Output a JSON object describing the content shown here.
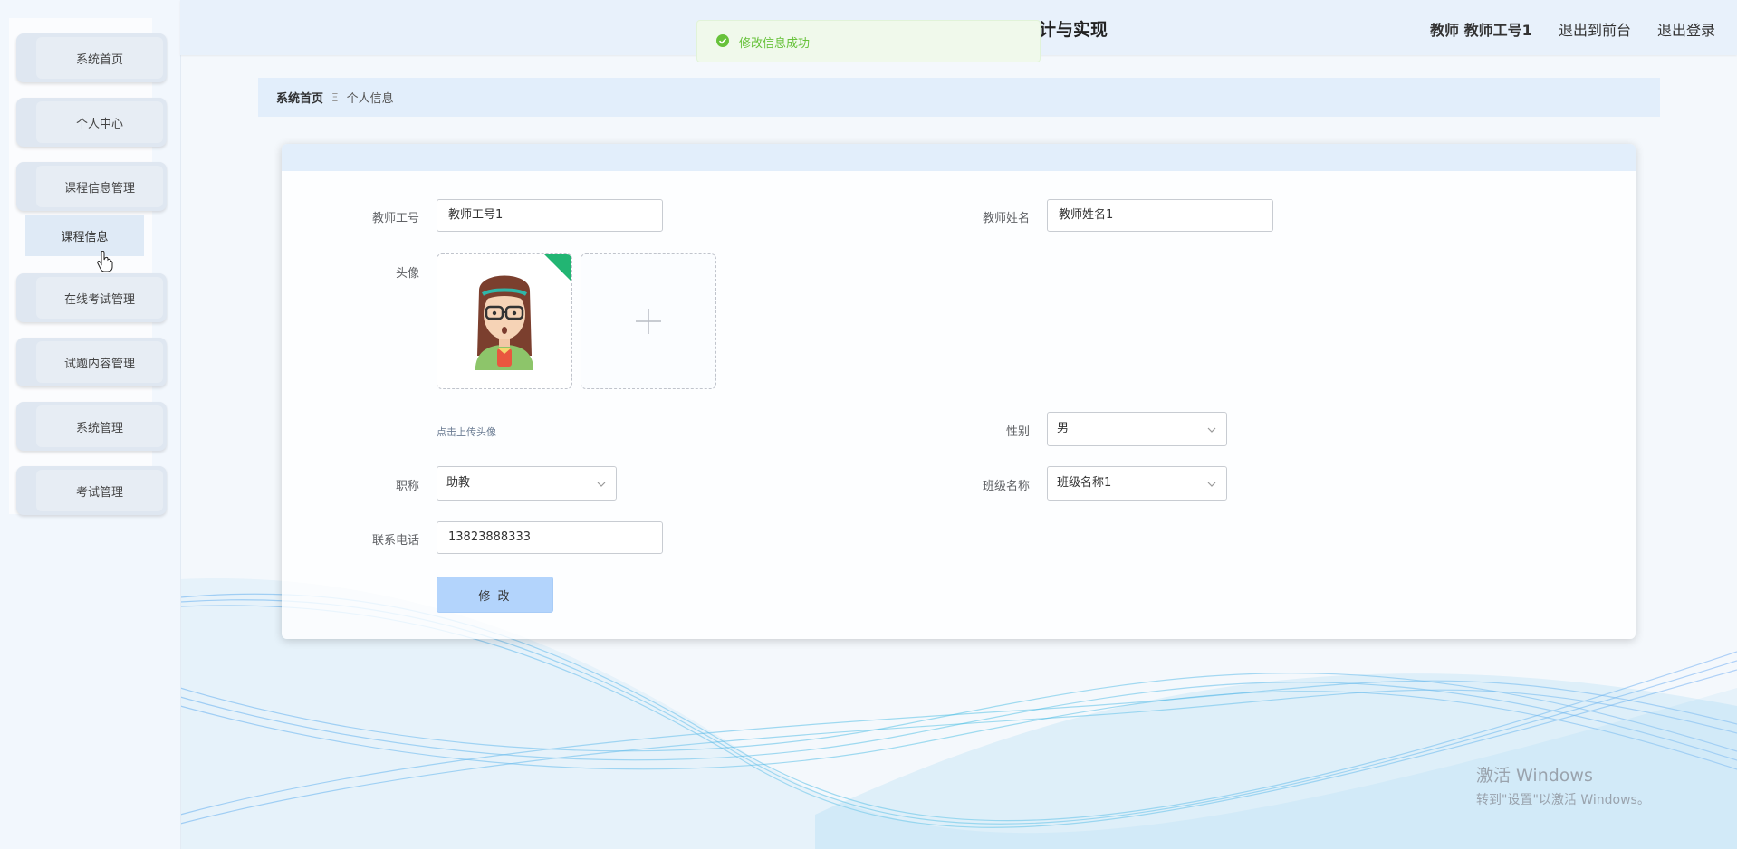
{
  "sidebar": {
    "items": [
      {
        "label": "系统首页"
      },
      {
        "label": "个人中心"
      },
      {
        "label": "课程信息管理"
      },
      {
        "label": "在线考试管理"
      },
      {
        "label": "试题内容管理"
      },
      {
        "label": "系统管理"
      },
      {
        "label": "考试管理"
      }
    ],
    "submenu": {
      "label": "课程信息"
    }
  },
  "header": {
    "title": "计与实现",
    "user_label": "教师 教师工号1",
    "front_link": "退出到前台",
    "logout_link": "退出登录"
  },
  "toast": {
    "text": "修改信息成功",
    "status_color": "#67c23a"
  },
  "breadcrumb": {
    "home": "系统首页",
    "separator": "Ξ",
    "current": "个人信息"
  },
  "form": {
    "teacher_id": {
      "label": "教师工号",
      "value": "教师工号1"
    },
    "teacher_name": {
      "label": "教师姓名",
      "value": "教师姓名1"
    },
    "avatar": {
      "label": "头像",
      "upload_hint": "点击上传头像"
    },
    "gender": {
      "label": "性别",
      "value": "男"
    },
    "title": {
      "label": "职称",
      "value": "助教"
    },
    "class_name": {
      "label": "班级名称",
      "value": "班级名称1"
    },
    "phone": {
      "label": "联系电话",
      "value": "13823888333"
    },
    "submit_label": "修 改"
  },
  "watermark": {
    "title": "激活 Windows",
    "subtitle": "转到\"设置\"以激活 Windows。"
  },
  "colors": {
    "accent": "#b3d4fc",
    "header_bg": "#e8f1fb",
    "success": "#67c23a"
  }
}
